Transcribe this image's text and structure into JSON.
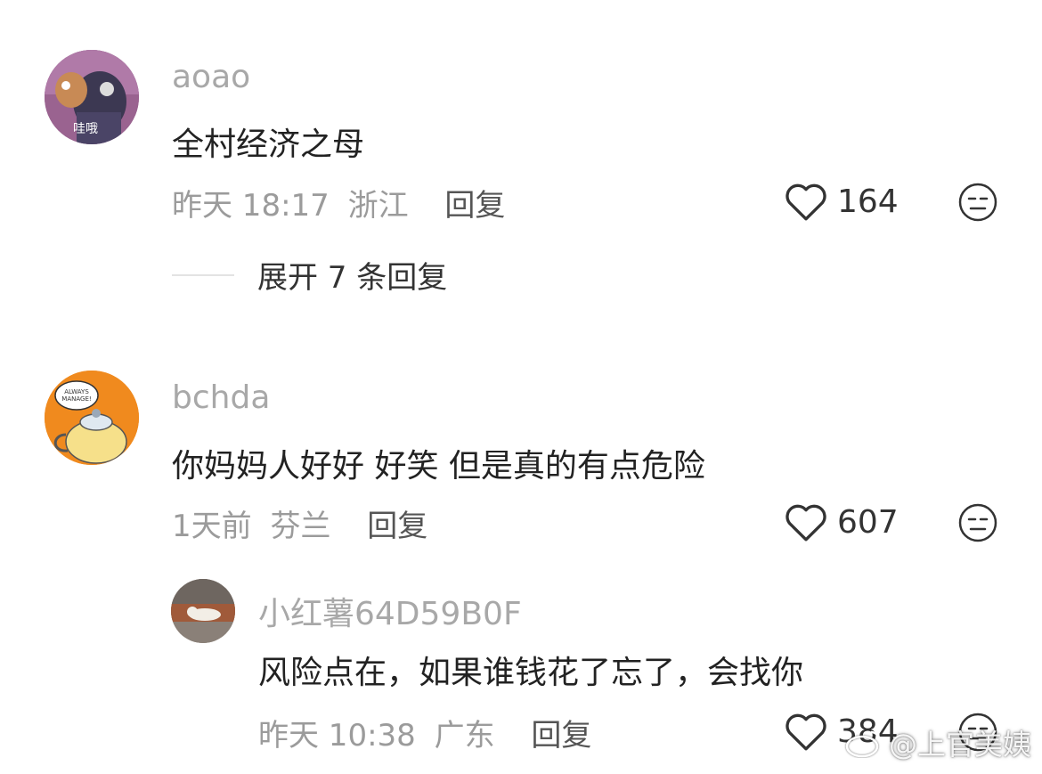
{
  "comments": [
    {
      "username": "aoao",
      "text": "全村经济之母",
      "time": "昨天 18:17",
      "location": "浙江",
      "reply_label": "回复",
      "likes": "164",
      "avatar_text": "哇哦",
      "expand_label": "展开 7 条回复"
    },
    {
      "username": "bchda",
      "text": "你妈妈人好好 好笑 但是真的有点危险",
      "time": "1天前",
      "location": "芬兰",
      "reply_label": "回复",
      "likes": "607",
      "avatar_text": "I ALWAYS MANAGE!"
    }
  ],
  "reply": {
    "username": "小红薯64D59B0F",
    "text": "风险点在，如果谁钱花了忘了，会找你",
    "time": "昨天 10:38",
    "location": "广东",
    "reply_label": "回复",
    "likes": "384"
  },
  "watermark": "@上官美姨",
  "colors": {
    "username": "#a8a8a8",
    "meta": "#9b9b9b",
    "text": "#222222",
    "avatar1_bg": "#8e5a85",
    "avatar2_bg": "#f08a1e"
  },
  "icons": [
    "heart-outline-icon",
    "neutral-face-icon",
    "weibo-logo-icon"
  ]
}
